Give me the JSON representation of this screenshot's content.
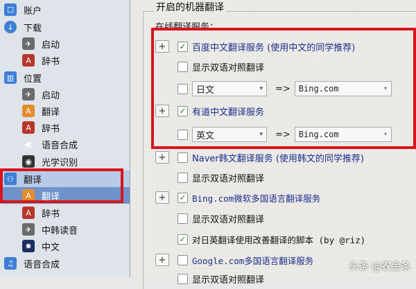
{
  "sidebar": {
    "items": [
      {
        "label": "账户",
        "icon": "account-icon"
      },
      {
        "label": "下载",
        "icon": "download-icon"
      },
      {
        "label": "启动",
        "icon": "launch-icon"
      },
      {
        "label": "辞书",
        "icon": "dictionary-icon"
      },
      {
        "label": "位置",
        "icon": "location-icon"
      },
      {
        "label": "启动",
        "icon": "launch-icon"
      },
      {
        "label": "翻译",
        "icon": "translate-icon"
      },
      {
        "label": "辞书",
        "icon": "dictionary-icon"
      },
      {
        "label": "语音合成",
        "icon": "speaker-icon"
      },
      {
        "label": "光学识别",
        "icon": "camera-lens-icon"
      },
      {
        "label": "翻译",
        "icon": "translate-group-icon"
      },
      {
        "label": "翻译",
        "icon": "translate-icon"
      },
      {
        "label": "辞书",
        "icon": "dictionary-icon"
      },
      {
        "label": "中韩读音",
        "icon": "korean-pronunciation-icon"
      },
      {
        "label": "中文",
        "icon": "chinese-icon"
      },
      {
        "label": "语音合成",
        "icon": "speech-synthesis-icon"
      }
    ]
  },
  "main": {
    "group_title": "开启的机器翻译",
    "service_label": "在线翻译服务：",
    "baidu": {
      "label": "百度中文翻译服务 (使用中文的同学推荐)",
      "checked": true
    },
    "baidu_bilingual": {
      "label": "显示双语对照翻译",
      "checked": false
    },
    "baidu_lang": {
      "from": "日文",
      "arrow": "=>",
      "to": "Bing.com"
    },
    "youdao": {
      "label": "有道中文翻译服务",
      "checked": true
    },
    "youdao_lang": {
      "from": "英文",
      "arrow": "=>",
      "to": "Bing.com"
    },
    "naver": {
      "label": "Naver韩文翻译服务 (使用韩文的同学推荐)",
      "checked": false
    },
    "naver_bilingual": {
      "label": "显示双语对照翻译",
      "checked": false
    },
    "bing": {
      "label": "Bing.com微软多国语言翻译服务",
      "checked": true
    },
    "bing_bilingual": {
      "label": "显示双语对照翻译",
      "checked": false
    },
    "bing_script": {
      "label": "对日英翻译使用改善翻译的脚本 (by @riz)",
      "checked": true
    },
    "google": {
      "label": "Google.com多国语言翻译服务",
      "checked": false
    },
    "google_bilingual": {
      "label": "显示双语对照翻译",
      "checked": false
    }
  },
  "glyphs": {
    "plus": "+",
    "check": "✓",
    "dropdown": "▾"
  },
  "colors": {
    "highlight_red": "#d8141c",
    "service_blue": "#1a2f8c",
    "selection_blue": "#6f93c9"
  },
  "watermark": "头条 @农金条"
}
